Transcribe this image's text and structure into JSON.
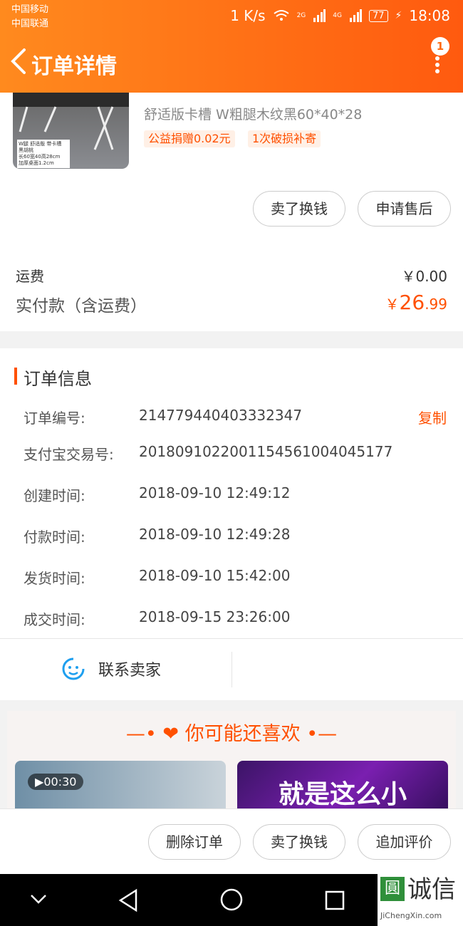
{
  "status_bar": {
    "carrier1": "中国移动",
    "carrier2": "中国联通",
    "speed": "1 K/s",
    "net1": "2G",
    "net2": "4G",
    "battery": "77",
    "time": "18:08"
  },
  "header": {
    "title": "订单详情",
    "badge": "1"
  },
  "product": {
    "sku": "舒适版卡槽 W粗腿木纹黑60*40*28",
    "tags": [
      "公益捐赠0.02元",
      "1次破损补寄"
    ],
    "thumb_text": [
      "W腿 舒适版 带卡槽",
      "黑胡桃",
      "长60宽40高28cm",
      "加厚桌面1.2cm"
    ],
    "actions": [
      "卖了换钱",
      "申请售后"
    ]
  },
  "fees": {
    "shipping_label": "运费",
    "shipping_value": "￥0.00",
    "paid_label": "实付款（含运费）",
    "paid_currency": "￥",
    "paid_int": "26",
    "paid_dec": ".99"
  },
  "order_info": {
    "title": "订单信息",
    "copy_label": "复制",
    "rows": [
      {
        "label": "订单编号:",
        "value": "214779440403332347"
      },
      {
        "label": "支付宝交易号:",
        "value": "2018091022001154561004045177"
      },
      {
        "label": "创建时间:",
        "value": "2018-09-10 12:49:12"
      },
      {
        "label": "付款时间:",
        "value": "2018-09-10 12:49:28"
      },
      {
        "label": "发货时间:",
        "value": "2018-09-10 15:42:00"
      },
      {
        "label": "成交时间:",
        "value": "2018-09-15 23:26:00"
      }
    ]
  },
  "contact": {
    "label": "联系卖家"
  },
  "recommend": {
    "title": "你可能还喜欢",
    "video_duration": "00:30",
    "card2_text": "就是这么小"
  },
  "bottom_actions": [
    "删除订单",
    "卖了换钱",
    "追加评价"
  ],
  "watermark": {
    "brand": "诚信",
    "url": "JiChengXin.com"
  },
  "colors": {
    "accent": "#ff5000",
    "header_start": "#ff8a1e",
    "header_end": "#ff5a0f"
  }
}
